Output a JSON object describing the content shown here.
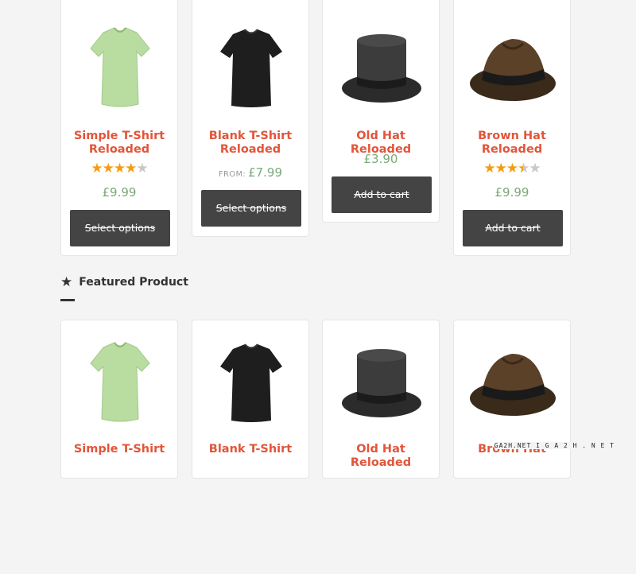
{
  "top_row": [
    {
      "name": "Simple T-Shirt Reloaded",
      "rating": "4 of 5",
      "price": "£9.99",
      "from": "",
      "button": "Select options",
      "image": "tshirt-green"
    },
    {
      "name": "Blank T-Shirt Reloaded",
      "rating": "",
      "price": "£7.99",
      "from": "FROM:",
      "button": "Select options",
      "image": "tshirt-black"
    },
    {
      "name": "Old Hat Reloaded",
      "rating": "",
      "price": "£3.90",
      "from": "",
      "button": "Add to cart",
      "image": "top-hat"
    },
    {
      "name": "Brown Hat Reloaded",
      "rating": "3.5 of 5",
      "price": "£9.99",
      "from": "",
      "button": "Add to cart",
      "image": "fedora-brown"
    }
  ],
  "featured": {
    "title": "Featured Product",
    "icon": "star-icon",
    "items": [
      {
        "name": "Simple T-Shirt",
        "image": "tshirt-green"
      },
      {
        "name": "Blank T-Shirt",
        "image": "tshirt-black"
      },
      {
        "name": "Old Hat Reloaded",
        "image": "top-hat"
      },
      {
        "name": "Brown Hat",
        "image": "fedora-brown"
      }
    ]
  },
  "watermark": "GA2H.NET I G A 2 H . N E T",
  "colors": {
    "product_name": "#e2553a",
    "price": "#7aa97a",
    "button": "#444444",
    "star": "#f39c12"
  }
}
